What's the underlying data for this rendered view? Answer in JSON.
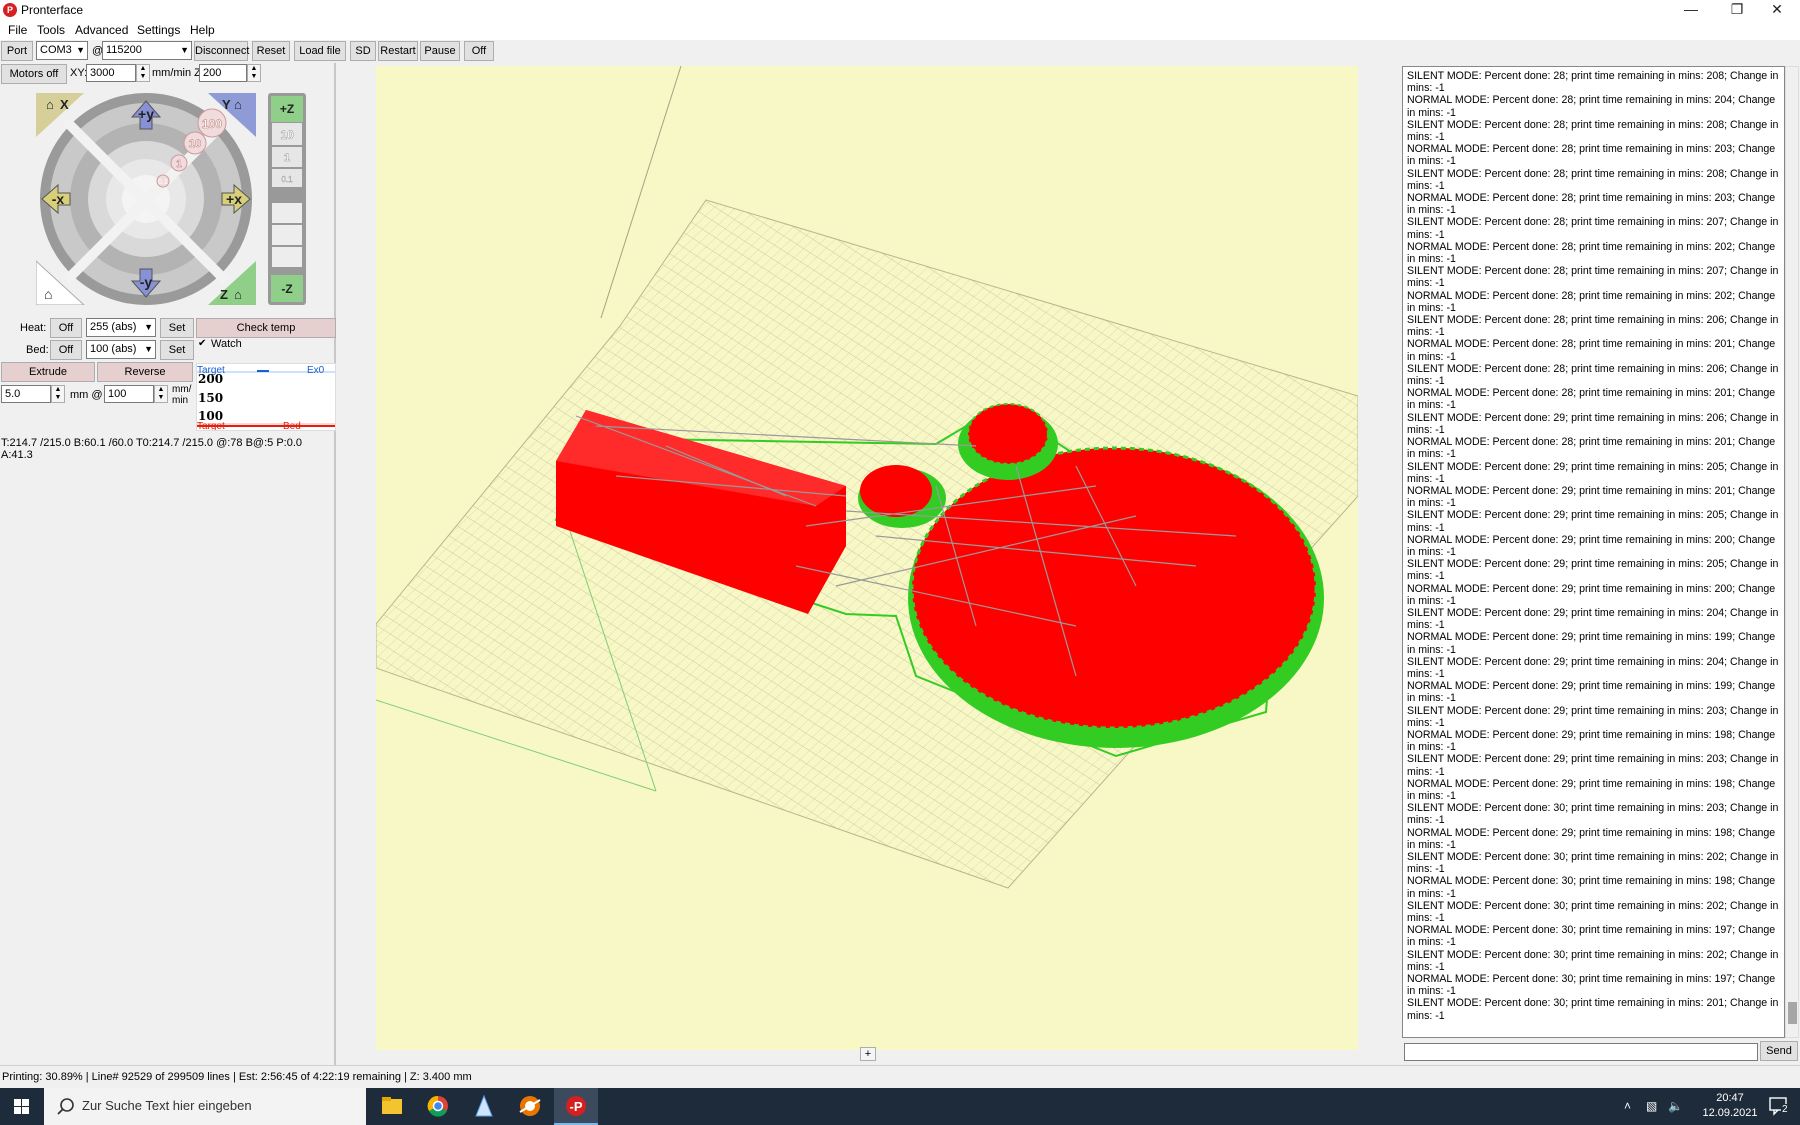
{
  "window": {
    "title": "Pronterface",
    "app_icon_text": "P"
  },
  "menu": [
    "File",
    "Tools",
    "Advanced",
    "Settings",
    "Help"
  ],
  "toolbar": {
    "port_label": "Port",
    "port_value": "COM3",
    "at_label": "@",
    "baud_value": "115200",
    "disconnect": "Disconnect",
    "reset": "Reset",
    "load_file": "Load file",
    "sd": "SD",
    "restart": "Restart",
    "pause": "Pause",
    "off": "Off"
  },
  "controls": {
    "motors_off": "Motors off",
    "xy_label": "XY:",
    "xy_value": "3000",
    "mm_min_z_label": "mm/min Z:",
    "z_value": "200",
    "jog": {
      "home_x": "X",
      "plus_y": "+y",
      "minus_y": "-y",
      "minus_x": "-x",
      "plus_x": "+x",
      "home_y": "Y",
      "home_z": "Z",
      "step_100": "100",
      "step_10": "10",
      "step_1": "1",
      "step_01": "0.1"
    },
    "zjog": {
      "plus_z": "+Z",
      "minus_z": "-Z",
      "s10": "10",
      "s1": "1",
      "s01": "0.1"
    },
    "heat_label": "Heat:",
    "heat_off": "Off",
    "heat_value": "255 (abs)",
    "heat_set": "Set",
    "bed_label": "Bed:",
    "bed_off": "Off",
    "bed_value": "100 (abs)",
    "bed_set": "Set",
    "check_temp": "Check temp",
    "watch_label": "Watch",
    "extrude": "Extrude",
    "reverse": "Reverse",
    "extrude_len": "5.0",
    "mm_at": "mm @",
    "extrude_speed": "100",
    "mm_min": "mm/\nmin",
    "graph": {
      "y200": "200",
      "y150": "150",
      "y100": "100",
      "target_top": "Target",
      "ex0": "Ex0",
      "target_bottom": "Target",
      "bed": "Bed"
    },
    "temp_status": "T:214.7 /215.0 B:60.1 /60.0 T0:214.7 /215.0 @:78 B@:5 P:0.0 A:41.3"
  },
  "log": [
    "SILENT MODE: Percent done: 28; print time remaining in mins: 208; Change in mins: -1",
    "NORMAL MODE: Percent done: 28; print time remaining in mins: 204; Change in mins: -1",
    "SILENT MODE: Percent done: 28; print time remaining in mins: 208; Change in mins: -1",
    "NORMAL MODE: Percent done: 28; print time remaining in mins: 203; Change in mins: -1",
    "SILENT MODE: Percent done: 28; print time remaining in mins: 208; Change in mins: -1",
    "NORMAL MODE: Percent done: 28; print time remaining in mins: 203; Change in mins: -1",
    "SILENT MODE: Percent done: 28; print time remaining in mins: 207; Change in mins: -1",
    "NORMAL MODE: Percent done: 28; print time remaining in mins: 202; Change in mins: -1",
    "SILENT MODE: Percent done: 28; print time remaining in mins: 207; Change in mins: -1",
    "NORMAL MODE: Percent done: 28; print time remaining in mins: 202; Change in mins: -1",
    "SILENT MODE: Percent done: 28; print time remaining in mins: 206; Change in mins: -1",
    "NORMAL MODE: Percent done: 28; print time remaining in mins: 201; Change in mins: -1",
    "SILENT MODE: Percent done: 28; print time remaining in mins: 206; Change in mins: -1",
    "NORMAL MODE: Percent done: 28; print time remaining in mins: 201; Change in mins: -1",
    "SILENT MODE: Percent done: 29; print time remaining in mins: 206; Change in mins: -1",
    "NORMAL MODE: Percent done: 28; print time remaining in mins: 201; Change in mins: -1",
    "SILENT MODE: Percent done: 29; print time remaining in mins: 205; Change in mins: -1",
    "NORMAL MODE: Percent done: 29; print time remaining in mins: 201; Change in mins: -1",
    "SILENT MODE: Percent done: 29; print time remaining in mins: 205; Change in mins: -1",
    "NORMAL MODE: Percent done: 29; print time remaining in mins: 200; Change in mins: -1",
    "SILENT MODE: Percent done: 29; print time remaining in mins: 205; Change in mins: -1",
    "NORMAL MODE: Percent done: 29; print time remaining in mins: 200; Change in mins: -1",
    "SILENT MODE: Percent done: 29; print time remaining in mins: 204; Change in mins: -1",
    "NORMAL MODE: Percent done: 29; print time remaining in mins: 199; Change in mins: -1",
    "SILENT MODE: Percent done: 29; print time remaining in mins: 204; Change in mins: -1",
    "NORMAL MODE: Percent done: 29; print time remaining in mins: 199; Change in mins: -1",
    "SILENT MODE: Percent done: 29; print time remaining in mins: 203; Change in mins: -1",
    "NORMAL MODE: Percent done: 29; print time remaining in mins: 198; Change in mins: -1",
    "SILENT MODE: Percent done: 29; print time remaining in mins: 203; Change in mins: -1",
    "NORMAL MODE: Percent done: 29; print time remaining in mins: 198; Change in mins: -1",
    "SILENT MODE: Percent done: 30; print time remaining in mins: 203; Change in mins: -1",
    "NORMAL MODE: Percent done: 29; print time remaining in mins: 198; Change in mins: -1",
    "SILENT MODE: Percent done: 30; print time remaining in mins: 202; Change in mins: -1",
    "NORMAL MODE: Percent done: 30; print time remaining in mins: 198; Change in mins: -1",
    "SILENT MODE: Percent done: 30; print time remaining in mins: 202; Change in mins: -1",
    "NORMAL MODE: Percent done: 30; print time remaining in mins: 197; Change in mins: -1",
    "SILENT MODE: Percent done: 30; print time remaining in mins: 202; Change in mins: -1",
    "NORMAL MODE: Percent done: 30; print time remaining in mins: 197; Change in mins: -1",
    "SILENT MODE: Percent done: 30; print time remaining in mins: 201; Change in mins: -1"
  ],
  "send_label": "Send",
  "plus_label": "+",
  "statusbar": "Printing: 30.89% | Line# 92529 of 299509 lines | Est: 2:56:45 of 4:22:19 remaining | Z: 3.400 mm",
  "taskbar": {
    "search_placeholder": "Zur Suche Text hier eingeben",
    "time": "20:47",
    "date": "12.09.2021",
    "notifications": "2"
  },
  "colors": {
    "bed": "#f8f7c6",
    "print": "#ff0000",
    "support": "#33cc22",
    "accent": "#1d2b3a"
  }
}
